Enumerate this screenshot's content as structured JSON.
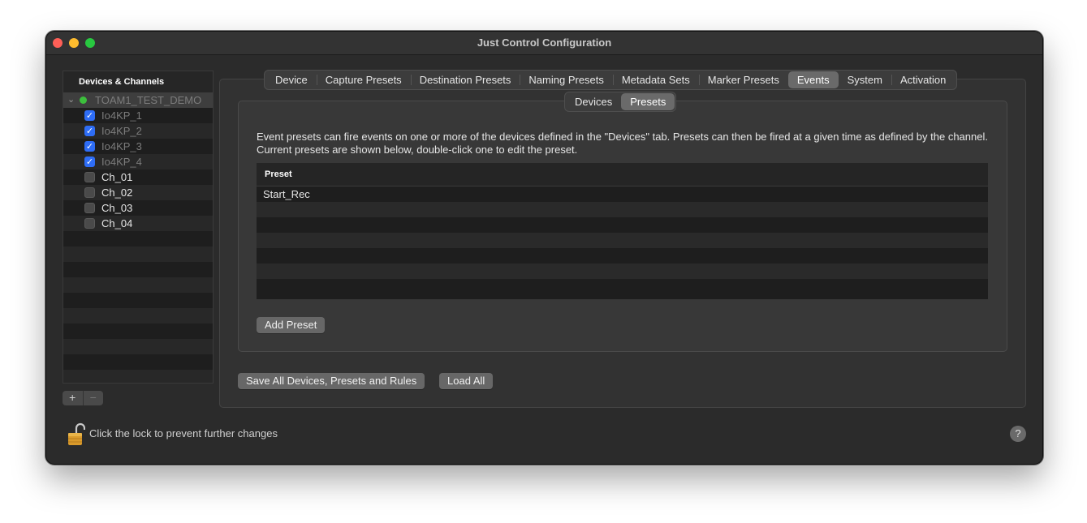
{
  "window": {
    "title": "Just Control Configuration"
  },
  "sidebar": {
    "header": "Devices & Channels",
    "device": {
      "name": "TOAM1_TEST_DEMO",
      "status": "online"
    },
    "channels": [
      {
        "label": "Io4KP_1",
        "checked": true
      },
      {
        "label": "Io4KP_2",
        "checked": true
      },
      {
        "label": "Io4KP_3",
        "checked": true
      },
      {
        "label": "Io4KP_4",
        "checked": true
      },
      {
        "label": "Ch_01",
        "checked": false
      },
      {
        "label": "Ch_02",
        "checked": false
      },
      {
        "label": "Ch_03",
        "checked": false
      },
      {
        "label": "Ch_04",
        "checked": false
      }
    ],
    "add_label": "+",
    "remove_label": "−"
  },
  "tabs": {
    "items": [
      "Device",
      "Capture Presets",
      "Destination Presets",
      "Naming Presets",
      "Metadata Sets",
      "Marker Presets",
      "Events",
      "System",
      "Activation"
    ],
    "active": "Events"
  },
  "subtabs": {
    "items": [
      "Devices",
      "Presets"
    ],
    "active": "Presets"
  },
  "events": {
    "description": "Event presets can fire events on one or more of the devices defined in the \"Devices\" tab. Presets can then be fired at a given time as defined by the channel. Current presets are shown below, double-click one to edit the preset.",
    "table_header": "Preset",
    "rows": [
      "Start_Rec"
    ],
    "add_button": "Add Preset"
  },
  "footer": {
    "save_all_button": "Save All Devices, Presets and Rules",
    "load_all_button": "Load All",
    "lock_text": "Click the lock to prevent further changes",
    "help_label": "?"
  },
  "colors": {
    "accent_checkbox": "#2e6df6",
    "status_online": "#3cbf3c"
  }
}
